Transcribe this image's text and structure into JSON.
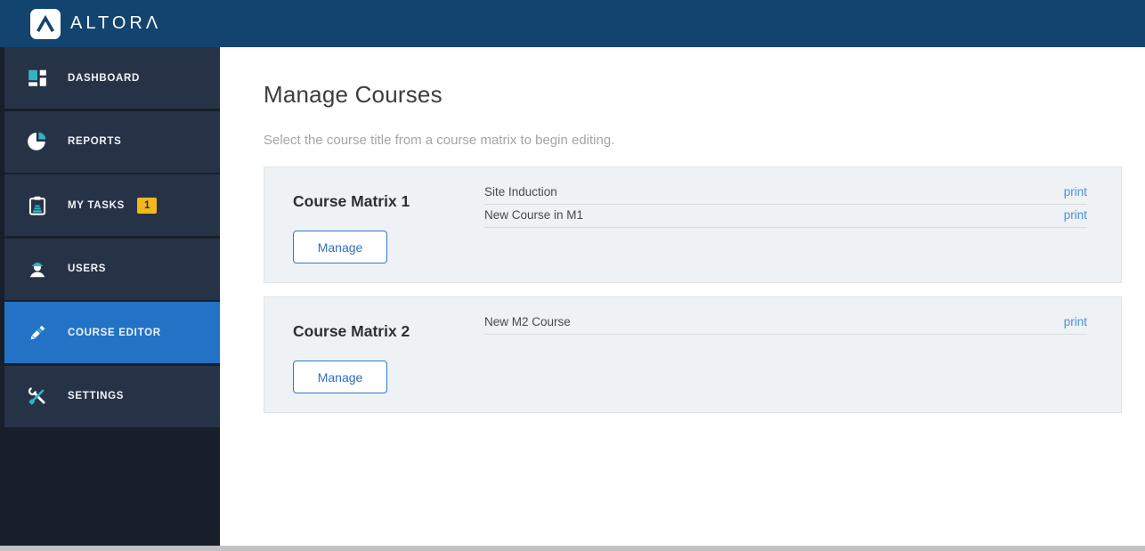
{
  "brand": {
    "name": "ALTORΛ",
    "logo_icon": "altora-logo-icon"
  },
  "colors": {
    "topbar": "#134470",
    "sidebar-base": "#161f2a",
    "sidebar-item": "#263347",
    "active-blue": "#2273c6",
    "teal": "#35b2c4",
    "badge-bg": "#f3b71d",
    "badge-text": "#22303f",
    "link-blue": "#4a90d9",
    "button-blue": "#2b6fc4",
    "button-border": "#2e79c9",
    "panel-bg": "#eff2f5",
    "panel-border": "#e2e5e8",
    "row-border": "#d8dbde",
    "title-text": "#3d3d3d",
    "muted-text": "#a5a5a5",
    "row-text": "#494949",
    "scrollbar": "#c1c1c1"
  },
  "sidebar": {
    "items": [
      {
        "id": "dashboard",
        "label": "DASHBOARD",
        "icon": "dashboard-icon",
        "active": false
      },
      {
        "id": "reports",
        "label": "REPORTS",
        "icon": "reports-icon",
        "active": false
      },
      {
        "id": "my-tasks",
        "label": "MY TASKS",
        "icon": "my-tasks-icon",
        "badge": "1",
        "active": false
      },
      {
        "id": "users",
        "label": "USERS",
        "icon": "users-icon",
        "active": false
      },
      {
        "id": "course-editor",
        "label": "COURSE EDITOR",
        "icon": "course-editor-icon",
        "active": true
      },
      {
        "id": "settings",
        "label": "SETTINGS",
        "icon": "settings-icon",
        "active": false
      }
    ]
  },
  "page": {
    "title": "Manage Courses",
    "subtitle": "Select the course title from a course matrix to begin editing."
  },
  "matrices": [
    {
      "title": "Course Matrix 1",
      "manage_label": "Manage",
      "courses": [
        {
          "name": "Site Induction",
          "print_label": "print"
        },
        {
          "name": "New Course in M1",
          "print_label": "print"
        }
      ]
    },
    {
      "title": "Course Matrix 2",
      "manage_label": "Manage",
      "courses": [
        {
          "name": "New M2 Course",
          "print_label": "print"
        }
      ]
    }
  ]
}
